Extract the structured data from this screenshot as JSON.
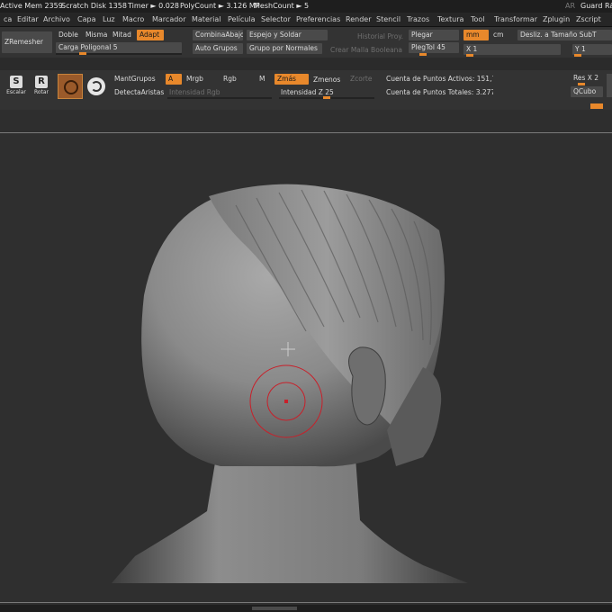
{
  "status": {
    "active_mem": "Active Mem 2359",
    "scratch_disk": "Scratch Disk 1358",
    "timer": "Timer ► 0.028",
    "polycount": "PolyCount ► 3.126 MP",
    "meshcount": "MeshCount ► 5",
    "ar_label": "AR",
    "guard": "Guard Rápi"
  },
  "menu": [
    "ca",
    "Editar",
    "Archivo",
    "Capa",
    "Luz",
    "Macro",
    "Marcador",
    "Material",
    "Película",
    "Selector",
    "Preferencias",
    "Render",
    "Stencil",
    "Trazos",
    "Textura",
    "Tool",
    "Transformar",
    "Zplugin",
    "Zscript"
  ],
  "remesher": {
    "button": "ZRemesher",
    "doble": "Doble",
    "misma": "Misma",
    "mitad": "Mitad",
    "adapt": "Adapt",
    "carga_poligonal": "Carga Poligonal 5"
  },
  "subtools": {
    "combina_abajo": "CombinaAbajo",
    "espejo_soldar": "Espejo y Soldar",
    "historial_proy": "Historial Proy.",
    "auto_grupos": "Auto Grupos",
    "grupo_normales": "Grupo por Normales",
    "crear_malla": "Crear Malla Booleana"
  },
  "plegar": {
    "plegar": "Plegar",
    "mm": "mm",
    "cm": "cm",
    "pleg_tol": "PlegTol 45",
    "x_value": "X 1",
    "desliz": "Desliz. a Tamaño SubT",
    "y_value": "Y 1"
  },
  "shelf": {
    "escalar": "Escalar",
    "rotar": "Rotar",
    "mant_grupos": "MantGrupos",
    "a": "A",
    "mrgb": "Mrgb",
    "rgb": "Rgb",
    "m": "M",
    "zmas": "Zmás",
    "zmenos": "Zmenos",
    "zcorte": "Zcorte",
    "detecta_aristas": "DetectaAristas",
    "intensidad_rgb": "Intensidad Rgb",
    "intensidad_z": "Intensidad Z 25",
    "puntos_activos": "Cuenta de Puntos Activos: 151,71",
    "puntos_totales": "Cuenta de Puntos Totales: 3.277 M",
    "res_x2": "Res X 2",
    "qcubo": "QCubo"
  },
  "colors": {
    "accent": "#e8882b",
    "panel": "#333333",
    "brush_ring": "#c8202a"
  }
}
